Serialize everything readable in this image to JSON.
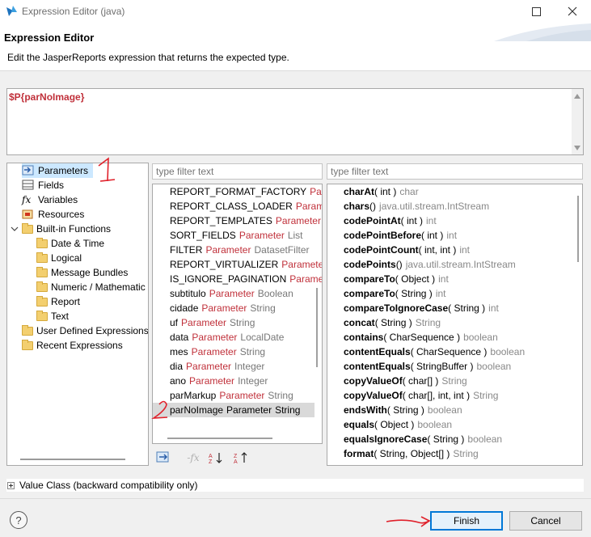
{
  "window": {
    "title": "Expression Editor (java)"
  },
  "header": {
    "title": "Expression Editor",
    "description": "Edit the JasperReports expression that returns the expected type."
  },
  "expression": {
    "value": "$P{parNoImage}"
  },
  "categories": {
    "items": [
      {
        "label": "Parameters",
        "icon": "parameters-icon"
      },
      {
        "label": "Fields",
        "icon": "fields-icon"
      },
      {
        "label": "Variables",
        "icon": "fx-icon"
      },
      {
        "label": "Resources",
        "icon": "resources-icon"
      },
      {
        "label": "Built-in Functions",
        "icon": "folder-icon"
      },
      {
        "label": "Date & Time",
        "icon": "folder-icon"
      },
      {
        "label": "Logical",
        "icon": "folder-icon"
      },
      {
        "label": "Message Bundles",
        "icon": "folder-icon"
      },
      {
        "label": "Numeric / Mathematic",
        "icon": "folder-icon"
      },
      {
        "label": "Report",
        "icon": "folder-icon"
      },
      {
        "label": "Text",
        "icon": "folder-icon"
      },
      {
        "label": "User Defined Expressions",
        "icon": "folder-icon"
      },
      {
        "label": "Recent Expressions",
        "icon": "folder-icon"
      }
    ],
    "selected": "Parameters"
  },
  "params_filter": {
    "placeholder": "type filter text"
  },
  "methods_filter": {
    "placeholder": "type filter text"
  },
  "params": [
    {
      "name": "REPORT_FORMAT_FACTORY",
      "kind": "Parameter",
      "type": ""
    },
    {
      "name": "REPORT_CLASS_LOADER",
      "kind": "Parameter",
      "type": ""
    },
    {
      "name": "REPORT_TEMPLATES",
      "kind": "Parameter",
      "type": "C"
    },
    {
      "name": "SORT_FIELDS",
      "kind": "Parameter",
      "type": "List"
    },
    {
      "name": "FILTER",
      "kind": "Parameter",
      "type": "DatasetFilter"
    },
    {
      "name": "REPORT_VIRTUALIZER",
      "kind": "Parameter",
      "type": ""
    },
    {
      "name": "IS_IGNORE_PAGINATION",
      "kind": "Parame",
      "type": ""
    },
    {
      "name": "subtitulo",
      "kind": "Parameter",
      "type": "Boolean"
    },
    {
      "name": "cidade",
      "kind": "Parameter",
      "type": "String"
    },
    {
      "name": "uf",
      "kind": "Parameter",
      "type": "String"
    },
    {
      "name": "data",
      "kind": "Parameter",
      "type": "LocalDate"
    },
    {
      "name": "mes",
      "kind": "Parameter",
      "type": "String"
    },
    {
      "name": "dia",
      "kind": "Parameter",
      "type": "Integer"
    },
    {
      "name": "ano",
      "kind": "Parameter",
      "type": "Integer"
    },
    {
      "name": "parMarkup",
      "kind": "Parameter",
      "type": "String"
    },
    {
      "name": "parNoImage",
      "kind": "Parameter",
      "type": "String"
    }
  ],
  "selected_param": "parNoImage",
  "methods": [
    {
      "name": "charAt",
      "args": "( int )",
      "ret": "char"
    },
    {
      "name": "chars",
      "args": "()",
      "ret": "java.util.stream.IntStream"
    },
    {
      "name": "codePointAt",
      "args": "( int )",
      "ret": "int"
    },
    {
      "name": "codePointBefore",
      "args": "( int )",
      "ret": "int"
    },
    {
      "name": "codePointCount",
      "args": "( int, int )",
      "ret": "int"
    },
    {
      "name": "codePoints",
      "args": "()",
      "ret": "java.util.stream.IntStream"
    },
    {
      "name": "compareTo",
      "args": "( Object )",
      "ret": "int"
    },
    {
      "name": "compareTo",
      "args": "( String )",
      "ret": "int"
    },
    {
      "name": "compareToIgnoreCase",
      "args": "( String )",
      "ret": "int"
    },
    {
      "name": "concat",
      "args": "( String )",
      "ret": "String"
    },
    {
      "name": "contains",
      "args": "( CharSequence )",
      "ret": "boolean"
    },
    {
      "name": "contentEquals",
      "args": "( CharSequence )",
      "ret": "boolean"
    },
    {
      "name": "contentEquals",
      "args": "( StringBuffer )",
      "ret": "boolean"
    },
    {
      "name": "copyValueOf",
      "args": "( char[] )",
      "ret": "String"
    },
    {
      "name": "copyValueOf",
      "args": "( char[], int, int )",
      "ret": "String"
    },
    {
      "name": "endsWith",
      "args": "( String )",
      "ret": "boolean"
    },
    {
      "name": "equals",
      "args": "( Object )",
      "ret": "boolean"
    },
    {
      "name": "equalsIgnoreCase",
      "args": "( String )",
      "ret": "boolean"
    },
    {
      "name": "format",
      "args": "( String, Object[] )",
      "ret": "String"
    }
  ],
  "value_class": {
    "label": "Value Class (backward compatibility only)"
  },
  "buttons": {
    "finish": "Finish",
    "cancel": "Cancel",
    "help": "?"
  },
  "annotations": {
    "mark_1": "1",
    "mark_2": "2"
  },
  "colors": {
    "accent": "#0078d7",
    "parameter_type": "#c0303a",
    "annotation": "#e0202a"
  }
}
